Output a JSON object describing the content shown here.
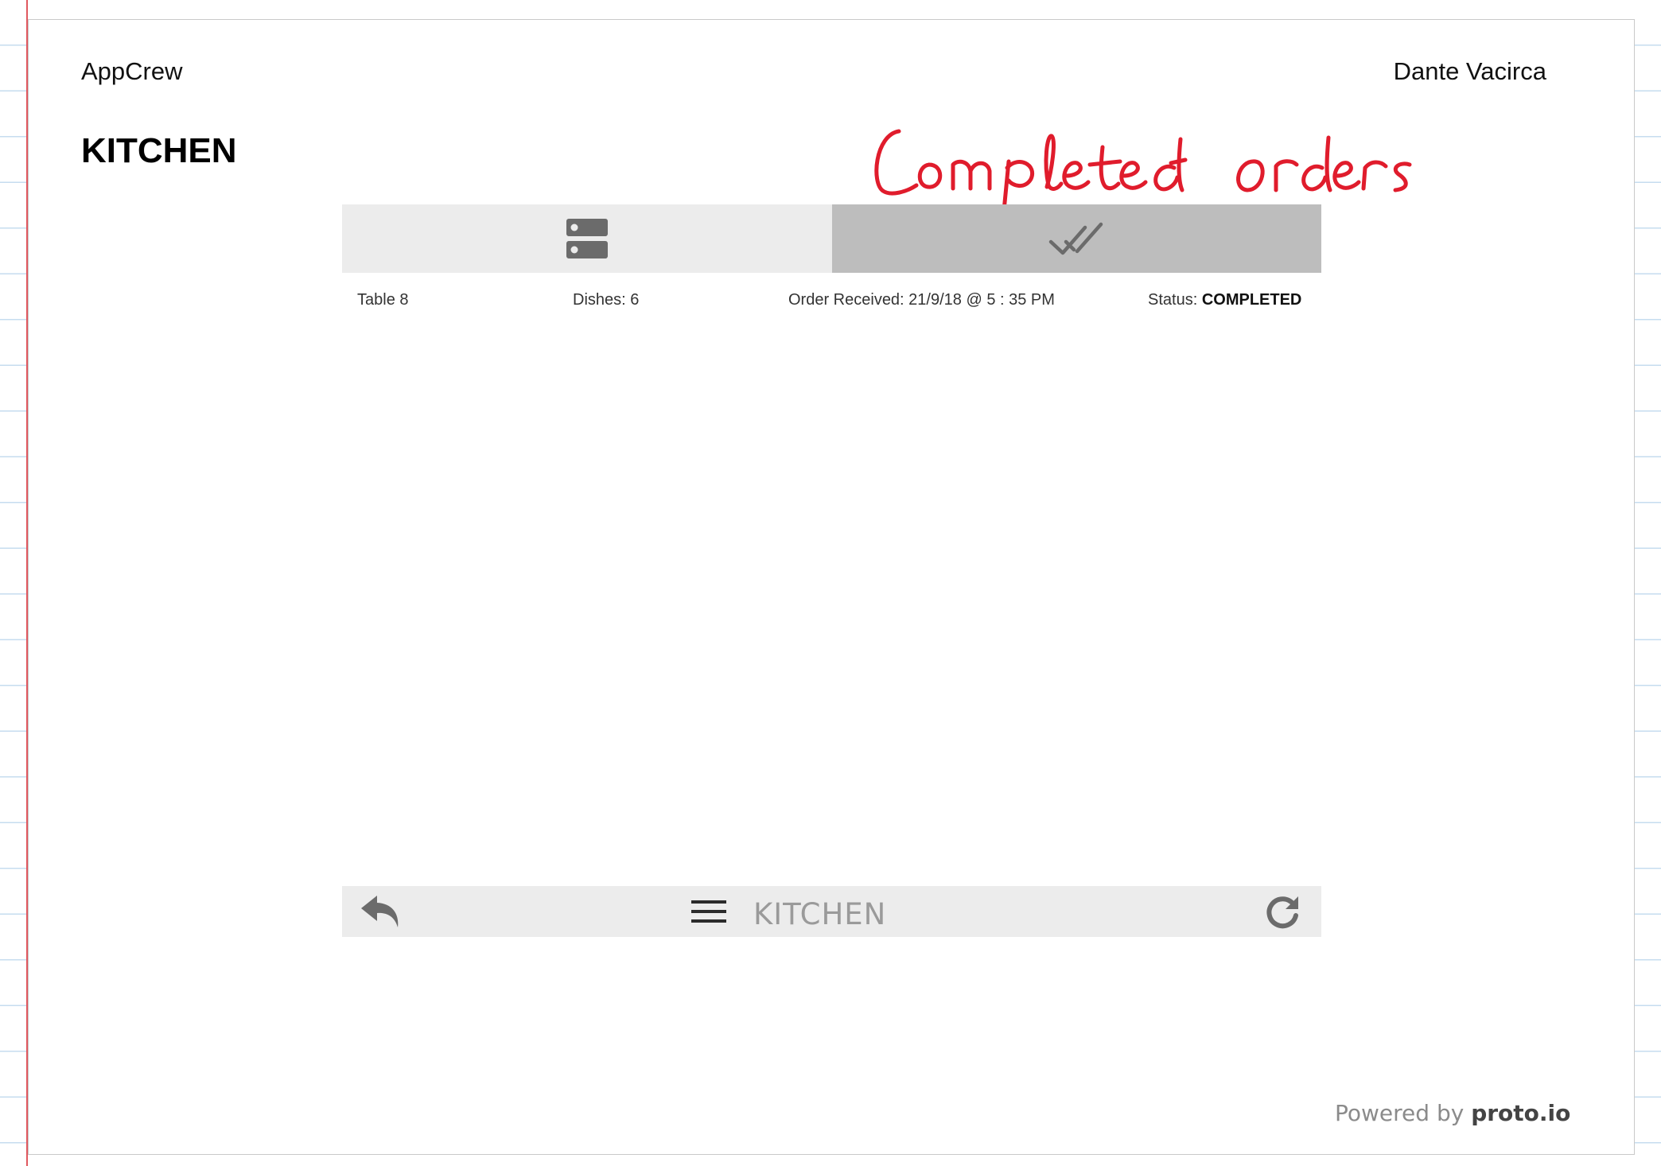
{
  "header": {
    "app_name": "AppCrew",
    "author": "Dante Vacirca"
  },
  "page": {
    "title": "KITCHEN"
  },
  "annotation": {
    "text": "Completed orders",
    "color": "#e01c2c"
  },
  "tabs": [
    {
      "name": "active-orders",
      "icon": "server-list-icon",
      "active": false
    },
    {
      "name": "completed-orders",
      "icon": "double-check-icon",
      "active": true
    }
  ],
  "order": {
    "table": "Table 8",
    "dishes": "Dishes: 6",
    "received": "Order Received: 21/9/18  @ 5 : 35 PM",
    "status_label": "Status: ",
    "status_value": "COMPLETED"
  },
  "bottom_bar": {
    "back_icon": "reply-arrow-icon",
    "menu_icon": "hamburger-menu-icon",
    "title": "KITCHEN",
    "refresh_icon": "refresh-icon"
  },
  "footer": {
    "powered_prefix": "Powered by ",
    "powered_brand": "proto.io"
  },
  "colors": {
    "tab_inactive": "#ececec",
    "tab_active": "#bdbdbd",
    "icon_gray": "#6b6b6b",
    "margin_red": "#e0585f",
    "ruled_line_blue": "#c6dcef"
  }
}
